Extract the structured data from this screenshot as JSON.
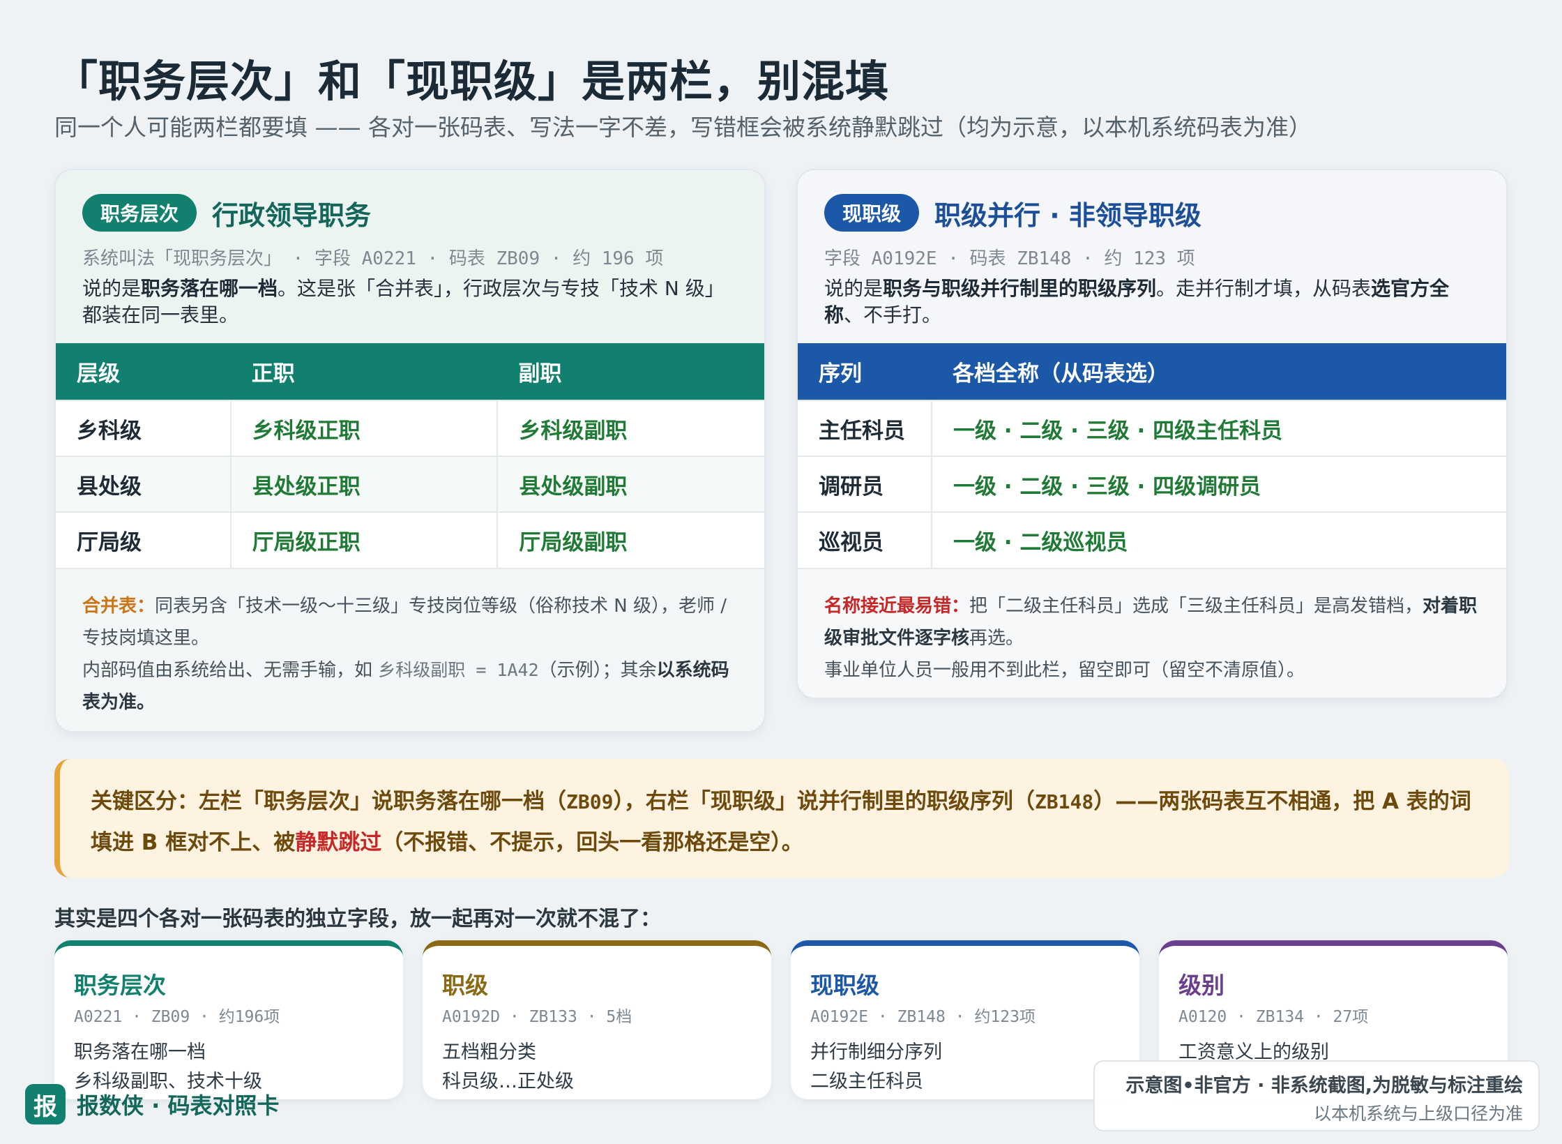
{
  "title": "「职务层次」和「现职级」是两栏，别混填",
  "subtitle": "同一个人可能两栏都要填 —— 各对一张码表、写法一字不差，写错框会被系统静默跳过（均为示意，以本机系统码表为准）",
  "left_panel": {
    "pill": "职务层次",
    "heading": "行政领导职务",
    "meta": "系统叫法「现职务层次」 · 字段 A0221 · 码表 ZB09 · 约 196 项",
    "desc_1": "说的是",
    "desc_bold": "职务落在哪一档",
    "desc_2": "。这是张「合并表」，行政层次与专技「技术 N 级」都装在同一表里。",
    "columns": [
      "层级",
      "正职",
      "副职"
    ],
    "rows": [
      [
        "乡科级",
        "乡科级正职",
        "乡科级副职"
      ],
      [
        "县处级",
        "县处级正职",
        "县处级副职"
      ],
      [
        "厅局级",
        "厅局级正职",
        "厅局级副职"
      ]
    ],
    "note_label": "合并表：",
    "note_1": "同表另含「技术一级～十三级」专技岗位等级（俗称技术 N 级），老师 / 专技岗填这里。",
    "note_2a": "内部码值由系统给出、无需手输，如 ",
    "note_code": "乡科级副职 = 1A42",
    "note_2b": "（示例）；其余",
    "note_bold": "以系统码表为准。"
  },
  "right_panel": {
    "pill": "现职级",
    "heading": "职级并行 · 非领导职级",
    "meta": "字段 A0192E · 码表 ZB148 · 约 123 项",
    "desc_1": "说的是",
    "desc_bold1": "职务与职级并行制里的职级序列",
    "desc_2": "。走并行制才填，从码表",
    "desc_bold2": "选官方全称",
    "desc_3": "、不手打。",
    "columns": [
      "序列",
      "各档全称（从码表选）"
    ],
    "rows": [
      [
        "主任科员",
        "一级 · 二级 · 三级 · 四级主任科员"
      ],
      [
        "调研员",
        "一级 · 二级 · 三级 · 四级调研员"
      ],
      [
        "巡视员",
        "一级 · 二级巡视员"
      ]
    ],
    "note_label": "名称接近最易错：",
    "note_1": "把「二级主任科员」选成「三级主任科员」是高发错档，",
    "note_bold": "对着职级审批文件逐字核",
    "note_1b": "再选。",
    "note_2": "事业单位人员一般用不到此栏，留空即可（留空不清原值）。"
  },
  "callout": {
    "part1": "关键区分：左栏「职务层次」说职务落在哪一档（",
    "code1": "ZB09",
    "part2": "），右栏「现职级」说并行制里的职级序列（",
    "code2": "ZB148",
    "part3": "）——两张码表互不相通，把 A 表的词填进 B 框对不上、被",
    "red": "静默跳过",
    "part4": "（不报错、不提示，回头一看那格还是空）。"
  },
  "cards_heading": "其实是四个各对一张码表的独立字段，放一起再对一次就不混了：",
  "cards": [
    {
      "title": "职务层次",
      "meta": "A0221 · ZB09 · 约196项",
      "line1": "职务落在哪一档",
      "line2": "乡科级副职、技术十级",
      "color": "#12806f"
    },
    {
      "title": "职级",
      "meta": "A0192D · ZB133 · 5档",
      "line1": "五档粗分类",
      "line2": "科员级…正处级",
      "color": "#8a6a14"
    },
    {
      "title": "现职级",
      "meta": "A0192E · ZB148 · 约123项",
      "line1": "并行制细分序列",
      "line2": "二级主任科员",
      "color": "#1c58a8"
    },
    {
      "title": "级别",
      "meta": "A0120 · ZB134 · 27项",
      "line1": "工资意义上的级别",
      "line2": "",
      "color": "#6a3f8e"
    }
  ],
  "brand": {
    "logo": "报",
    "text": "报数侠 · 码表对照卡"
  },
  "disclaimer": {
    "line1": "示意图•非官方 · 非系统截图,为脱敏与标注重绘",
    "line2": "以本机系统与上级口径为准"
  }
}
